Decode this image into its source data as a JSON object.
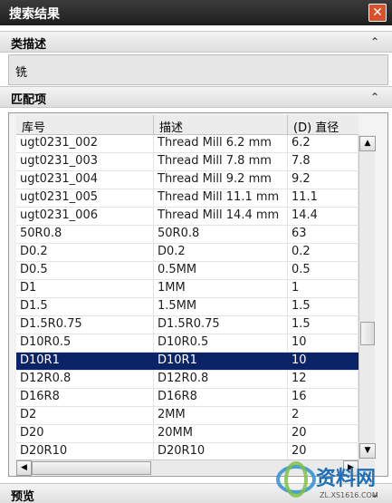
{
  "window": {
    "title": "搜索结果",
    "close_label": "✕"
  },
  "category_section": {
    "title": "类描述",
    "collapse_label": "⌃",
    "value": "铣"
  },
  "match_section": {
    "title": "匹配项",
    "collapse_label": "⌃",
    "columns": [
      "库号",
      "描述",
      "(D) 直径"
    ],
    "rows": [
      [
        "ugt0231_002",
        "Thread Mill 6.2 mm",
        "6.2"
      ],
      [
        "ugt0231_003",
        "Thread Mill 7.8 mm",
        "7.8"
      ],
      [
        "ugt0231_004",
        "Thread Mill 9.2 mm",
        "9.2"
      ],
      [
        "ugt0231_005",
        "Thread Mill 11.1 mm",
        "11.1"
      ],
      [
        "ugt0231_006",
        "Thread Mill 14.4 mm",
        "14.4"
      ],
      [
        "50R0.8",
        "50R0.8",
        "63"
      ],
      [
        "D0.2",
        "D0.2",
        "0.2"
      ],
      [
        "D0.5",
        "0.5MM",
        "0.5"
      ],
      [
        "D1",
        "1MM",
        "1"
      ],
      [
        "D1.5",
        "1.5MM",
        "1.5"
      ],
      [
        "D1.5R0.75",
        "D1.5R0.75",
        "1.5"
      ],
      [
        "D10R0.5",
        "D10R0.5",
        "10"
      ],
      [
        "D10R1",
        "D10R1",
        "10"
      ],
      [
        "D12R0.8",
        "D12R0.8",
        "12"
      ],
      [
        "D16R8",
        "D16R8",
        "16"
      ],
      [
        "D2",
        "2MM",
        "2"
      ],
      [
        "D20",
        "20MM",
        "20"
      ],
      [
        "D20R10",
        "D20R10",
        "20"
      ]
    ],
    "selected_row": 12
  },
  "preview_section": {
    "title": "预览",
    "collapse_label": "⌄"
  },
  "watermark": {
    "text": "资料网",
    "url_text": "ZL.XS1616.COM"
  },
  "colors": {
    "selection": "#0b2468",
    "titlebar": "#1e1e1e",
    "close": "#d9512a"
  }
}
